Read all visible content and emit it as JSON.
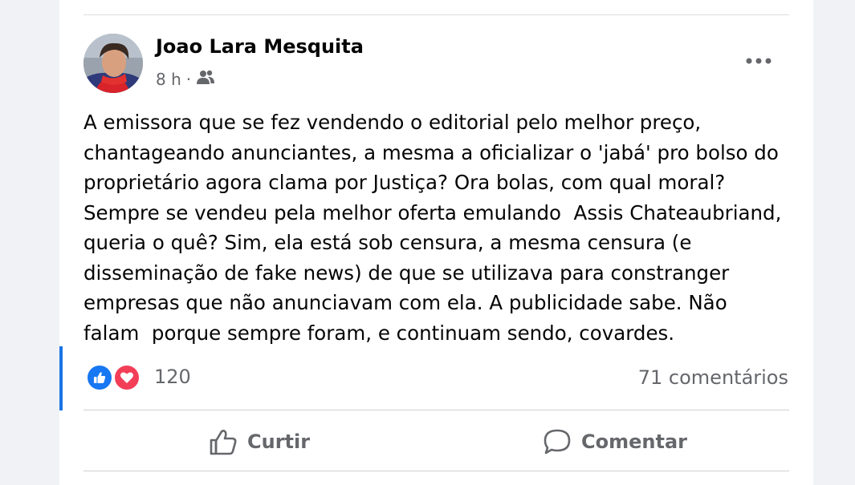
{
  "post": {
    "author_name": "Joao Lara Mesquita",
    "time": "8 h",
    "separator": "·",
    "audience_icon": "friends-icon",
    "more_icon": "more-horizontal-icon",
    "text_lines": [
      "A emissora que se fez vendendo o editorial pelo melhor preço,",
      "chantageando anunciantes, a mesma a oficializar o 'jabá' pro bolso do",
      "proprietário agora clama por Justiça? Ora bolas, com qual moral?",
      "Sempre se vendeu pela melhor oferta emulando  Assis Chateaubriand,",
      "queria o quê? Sim, ela está sob censura, a mesma censura (e",
      "disseminação de fake news) de que se utilizava para constranger",
      "empresas que não anunciavam com ela. A publicidade sabe. Não",
      "falam  porque sempre foram, e continuam sendo, covardes."
    ]
  },
  "stats": {
    "reaction_icons": [
      "like-icon",
      "love-icon"
    ],
    "reaction_count": "120",
    "comments": "71 comentários"
  },
  "actions": {
    "like_label": "Curtir",
    "comment_label": "Comentar"
  },
  "colors": {
    "brand_blue": "#1877f2",
    "love_red": "#f33e58",
    "secondary_text": "#65676b",
    "accent_bar": "#1b74e4"
  }
}
